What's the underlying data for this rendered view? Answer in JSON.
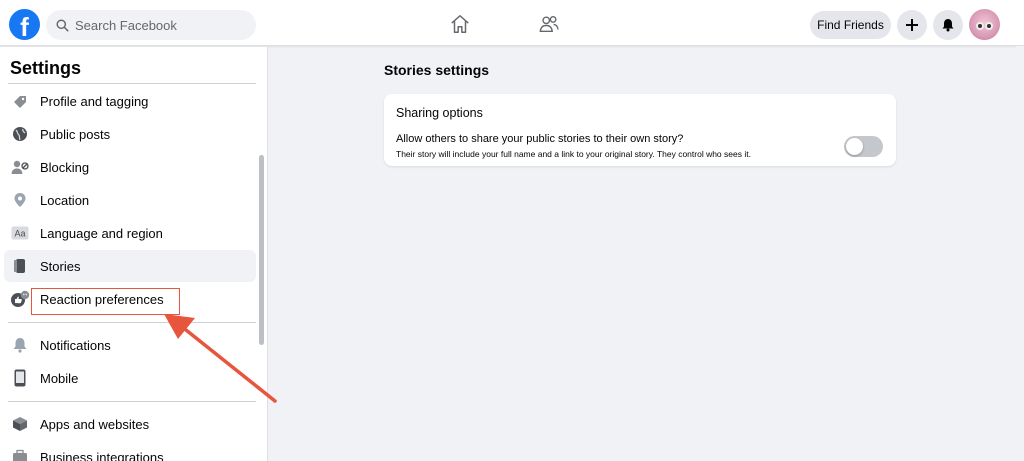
{
  "header": {
    "logo_letter": "f",
    "search_placeholder": "Search Facebook",
    "find_friends_label": "Find Friends"
  },
  "sidebar": {
    "title": "Settings",
    "items": [
      {
        "label": "Profile and tagging",
        "icon": "tag-icon"
      },
      {
        "label": "Public posts",
        "icon": "globe-icon"
      },
      {
        "label": "Blocking",
        "icon": "block-user-icon"
      },
      {
        "label": "Location",
        "icon": "location-pin-icon"
      },
      {
        "label": "Language and region",
        "icon": "language-icon"
      },
      {
        "label": "Stories",
        "icon": "stories-icon",
        "active": true
      },
      {
        "label": "Reaction preferences",
        "icon": "reactions-icon"
      },
      {
        "label": "Notifications",
        "icon": "bell-icon"
      },
      {
        "label": "Mobile",
        "icon": "mobile-phone-icon"
      },
      {
        "label": "Apps and websites",
        "icon": "apps-icon"
      },
      {
        "label": "Business integrations",
        "icon": "business-icon"
      }
    ]
  },
  "main": {
    "section_title": "Stories settings",
    "card": {
      "title": "Sharing options",
      "question": "Allow others to share your public stories to their own story?",
      "description": "Their story will include your full name and a link to your original story. They control who sees it.",
      "toggle_on": false
    }
  },
  "colors": {
    "brand_blue": "#1877f2",
    "annotation_red": "#e8553d",
    "page_bg": "#f0f2f5"
  }
}
